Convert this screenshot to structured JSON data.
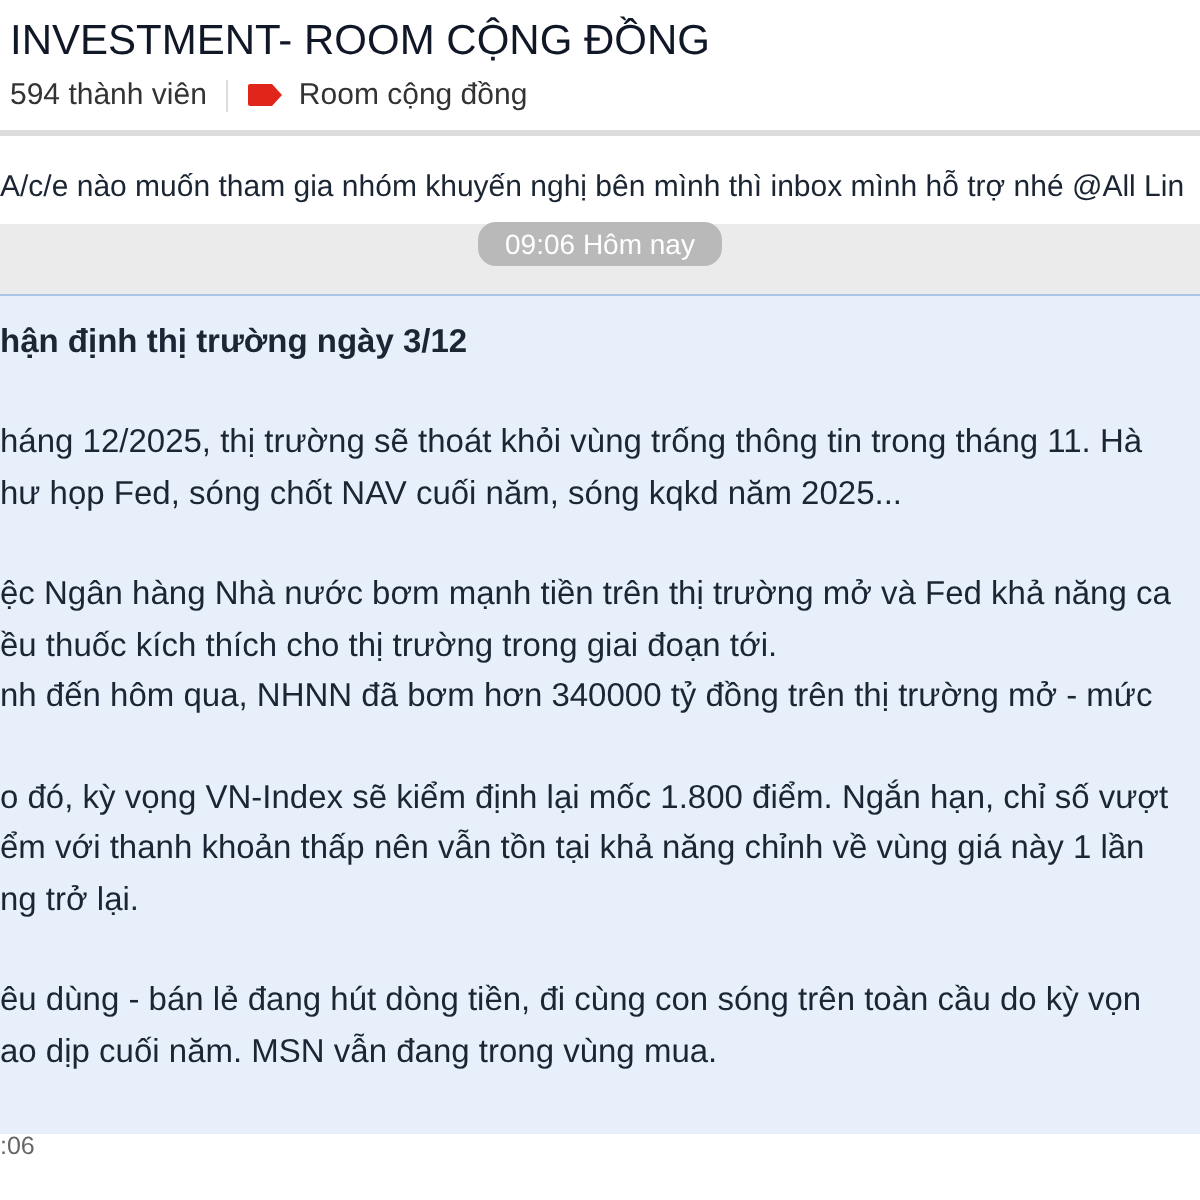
{
  "header": {
    "title": "INVESTMENT- ROOM CỘNG ĐỒNG",
    "members": "594 thành viên",
    "tag": "Room cộng đồng"
  },
  "pinned": {
    "text": "A/c/e nào muốn tham gia nhóm khuyến nghị bên mình thì inbox mình hỗ trợ nhé @All  Lin"
  },
  "time_divider": "09:06 Hôm nay",
  "message": {
    "heading": "hận định thị trường ngày 3/12",
    "paragraphs": [
      [
        "háng 12/2025, thị trường sẽ thoát khỏi vùng trống thông tin trong tháng 11. Hà",
        "hư họp Fed, sóng chốt NAV cuối năm, sóng kqkd năm 2025..."
      ],
      [
        "ệc Ngân hàng Nhà nước bơm mạnh tiền trên thị trường mở và Fed khả năng ca",
        "ều thuốc kích thích cho thị trường trong giai đoạn tới.",
        "nh đến hôm qua, NHNN đã bơm hơn 340000 tỷ đồng trên thị trường mở - mức"
      ],
      [
        "o đó, kỳ vọng VN-Index sẽ kiểm định lại mốc 1.800 điểm. Ngắn hạn, chỉ số vượt",
        "ểm với thanh khoản thấp nên vẫn tồn tại khả năng chỉnh về vùng giá này 1 lần",
        "ng trở lại."
      ],
      [
        "êu dùng - bán lẻ đang hút dòng tiền, đi cùng con sóng trên toàn cầu do kỳ vọn",
        "ao dịp cuối năm. MSN vẫn đang trong vùng mua."
      ]
    ],
    "time": ":06"
  }
}
